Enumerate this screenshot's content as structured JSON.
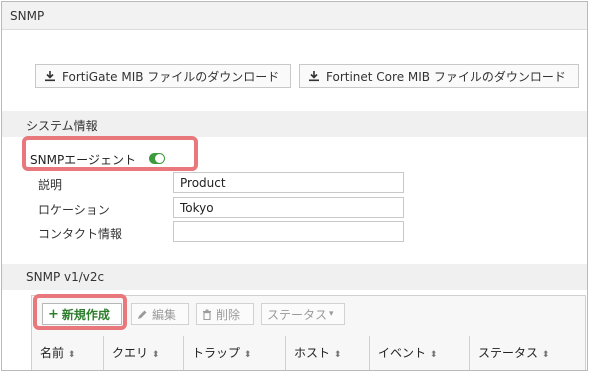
{
  "window": {
    "title": "SNMP"
  },
  "downloads": {
    "fortigate_mib_label": "FortiGate MIB ファイルのダウンロード",
    "fortinet_core_mib_label": "Fortinet Core MIB ファイルのダウンロード",
    "icon": "download-icon"
  },
  "system_info": {
    "heading": "システム情報",
    "agent_label": "SNMPエージェント",
    "agent_enabled": true,
    "fields": [
      {
        "label": "説明",
        "value": "Product"
      },
      {
        "label": "ロケーション",
        "value": "Tokyo"
      },
      {
        "label": "コンタクト情報",
        "value": ""
      }
    ]
  },
  "snmp_v1v2c": {
    "heading": "SNMP v1/v2c",
    "toolbar": {
      "new_label": "新規作成",
      "edit_label": "編集",
      "delete_label": "削除",
      "status_label": "ステータス"
    },
    "columns": [
      "名前",
      "クエリ",
      "トラップ",
      "ホスト",
      "イベント",
      "ステータス"
    ]
  },
  "colors": {
    "highlight": "#e8787b",
    "toggle_on": "#3c9c3c",
    "new_button_text": "#2d7d2d"
  }
}
